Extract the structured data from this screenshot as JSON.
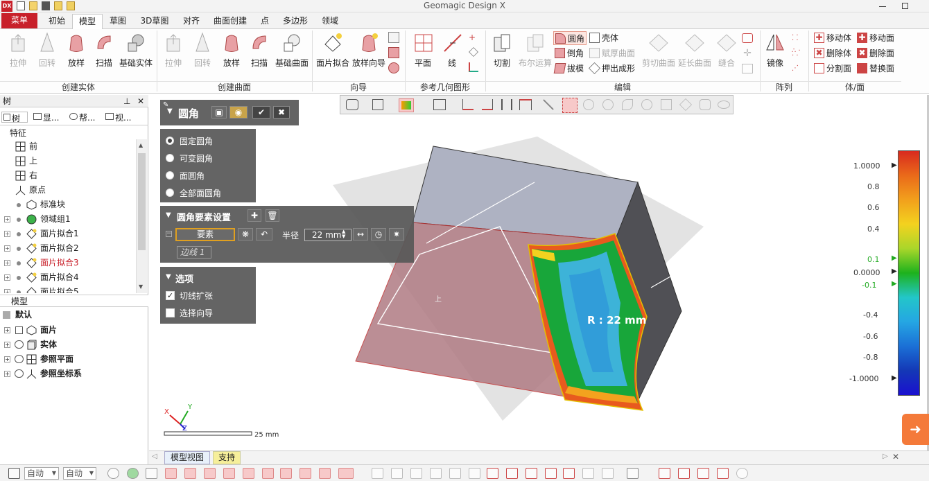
{
  "app": {
    "title": "Geomagic Design X",
    "logo_text": "DX"
  },
  "tabs": [
    {
      "label": "菜单"
    },
    {
      "label": "初始"
    },
    {
      "label": "模型"
    },
    {
      "label": "草图"
    },
    {
      "label": "3D草图"
    },
    {
      "label": "对齐"
    },
    {
      "label": "曲面创建"
    },
    {
      "label": "点"
    },
    {
      "label": "多边形"
    },
    {
      "label": "领域"
    }
  ],
  "ribbon": {
    "groups": [
      "创建实体",
      "创建曲面",
      "向导",
      "参考几何图形",
      "编辑",
      "阵列",
      "体/面"
    ],
    "create_solid": [
      "拉伸",
      "回转",
      "放样",
      "扫描",
      "基础实体"
    ],
    "create_surface": [
      "拉伸",
      "回转",
      "放样",
      "扫描",
      "基础曲面"
    ],
    "wizard": [
      "面片拟合",
      "放样向导"
    ],
    "ref_geometry": [
      "平面",
      "线"
    ],
    "edit_big": [
      "切割",
      "布尔运算",
      "剪切曲面",
      "延长曲面",
      "缝合"
    ],
    "edit_small": [
      "圆角",
      "壳体",
      "倒角",
      "赋厚曲面",
      "拔模",
      "押出成形"
    ],
    "pattern": [
      "镜像"
    ],
    "body_face": [
      "移动体",
      "移动面",
      "删除体",
      "删除面",
      "分割面",
      "替换面"
    ]
  },
  "left_panel": {
    "title": "树",
    "tabs": [
      "树",
      "显...",
      "帮...",
      "视..."
    ],
    "section_features": "特征",
    "features": [
      {
        "label": "前",
        "icon": "plane-icon"
      },
      {
        "label": "上",
        "icon": "plane-icon"
      },
      {
        "label": "右",
        "icon": "plane-icon"
      },
      {
        "label": "原点",
        "icon": "origin-icon"
      },
      {
        "label": "标准块",
        "icon": "block-icon"
      },
      {
        "label": "领域组1",
        "icon": "region-icon"
      },
      {
        "label": "面片拟合1",
        "icon": "fit-icon"
      },
      {
        "label": "面片拟合2",
        "icon": "fit-icon"
      },
      {
        "label": "面片拟合3",
        "icon": "fit-icon",
        "highlight": true
      },
      {
        "label": "面片拟合4",
        "icon": "fit-icon"
      },
      {
        "label": "面片拟合5",
        "icon": "fit-icon"
      }
    ],
    "section_model": "模型",
    "default_label": "默认",
    "model_items": [
      "面片",
      "实体",
      "参照平面",
      "参照坐标系"
    ]
  },
  "fillet_dialog": {
    "title": "圆角",
    "modes": [
      "固定圆角",
      "可变圆角",
      "面圆角",
      "全部面圆角"
    ],
    "selected_mode": 0,
    "element_settings_title": "圆角要素设置",
    "element_button": "要素",
    "radius_label": "半径",
    "radius_value": "22 mm",
    "edge_item": "边线 1",
    "options_title": "选项",
    "options": [
      {
        "label": "切线扩张",
        "checked": true
      },
      {
        "label": "选择向导",
        "checked": false
      }
    ]
  },
  "viewport": {
    "radius_annotation": "R : 22 mm",
    "small_label": "上",
    "scale_label": "25 mm",
    "axes": {
      "x": "X",
      "y": "Y",
      "z": "Z"
    }
  },
  "legend": {
    "ticks": [
      "1.0000",
      "0.8",
      "0.6",
      "0.4",
      "0.1",
      "0.0000",
      "-0.1",
      "-0.4",
      "-0.6",
      "-0.8",
      "-1.0000"
    ],
    "colors": [
      "#d82a1e",
      "#ea6a1a",
      "#f2a01c",
      "#f3d21f",
      "#a9d62a",
      "#1db21d",
      "#23c6c9",
      "#25a6e3",
      "#1b70d6",
      "#1438b6",
      "#1a10d0"
    ]
  },
  "bottom_tabs": [
    "模型视图",
    "支持"
  ],
  "status_bar": {
    "combo1": "自动",
    "combo2": "自动"
  }
}
